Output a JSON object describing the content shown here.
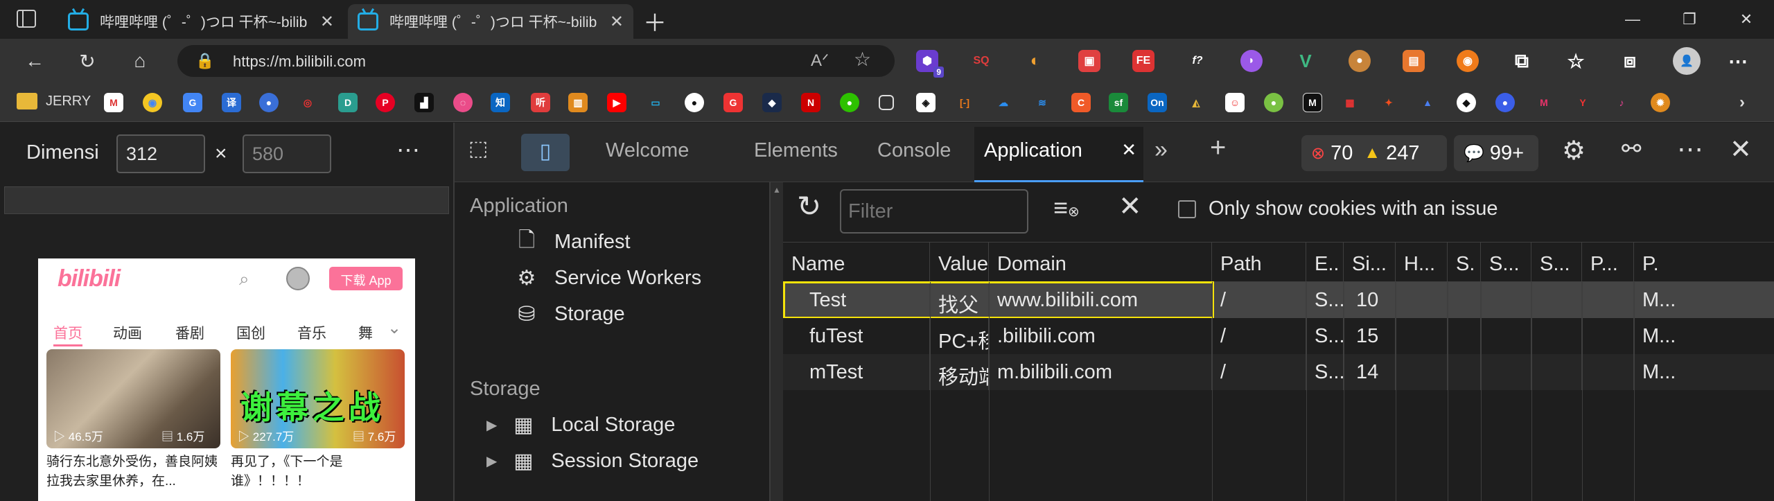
{
  "tabs": [
    {
      "title": "哔哩哔哩 (゜-゜)つロ 干杯~-bilib"
    },
    {
      "title": "哔哩哔哩 (゜-゜)つロ 干杯~-bilib"
    }
  ],
  "address": {
    "url": "https://m.bilibili.com"
  },
  "extensions": {
    "badge_count": "9"
  },
  "bookmarks": {
    "first_label": "JERRY"
  },
  "device": {
    "dimension_label": "Dimensi",
    "width": "312",
    "height": "580",
    "times": "×"
  },
  "phone": {
    "logo": "bilibili",
    "download": "下载 App",
    "tabs": [
      "首页",
      "动画",
      "番剧",
      "国创",
      "音乐",
      "舞"
    ],
    "cards": [
      {
        "views": "46.5万",
        "danmaku": "1.6万",
        "caption": "骑行东北意外受伤，善良阿姨拉我去家里休养，在..."
      },
      {
        "views": "227.7万",
        "danmaku": "7.6万",
        "overlay": "谢幕之战",
        "caption": "再见了，《下一个是谁》！！！！"
      }
    ]
  },
  "devtools": {
    "tabs": [
      "Welcome",
      "Elements",
      "Console",
      "Application"
    ],
    "active_tab": "Application",
    "errors": "70",
    "warnings": "247",
    "messages": "99+",
    "sidebar": {
      "application_header": "Application",
      "items": [
        "Manifest",
        "Service Workers",
        "Storage"
      ],
      "storage_header": "Storage",
      "storage_items": [
        "Local Storage",
        "Session Storage"
      ]
    },
    "filter_placeholder": "Filter",
    "only_issue_label": "Only show cookies with an issue",
    "columns": [
      "Name",
      "Value",
      "Domain",
      "Path",
      "E..",
      "Si...",
      "H...",
      "S.",
      "S...",
      "S...",
      "P...",
      "P."
    ],
    "cookies": [
      {
        "name": "Test",
        "value": "找父",
        "domain": "www.bilibili.com",
        "path": "/",
        "expires": "S...",
        "size": "10",
        "priority": "M..."
      },
      {
        "name": "fuTest",
        "value": "PC+移...",
        "domain": ".bilibili.com",
        "path": "/",
        "expires": "S...",
        "size": "15",
        "priority": "M..."
      },
      {
        "name": "mTest",
        "value": "移动端",
        "domain": "m.bilibili.com",
        "path": "/",
        "expires": "S...",
        "size": "14",
        "priority": "M..."
      }
    ],
    "highlight_color": "#f5e30a"
  }
}
